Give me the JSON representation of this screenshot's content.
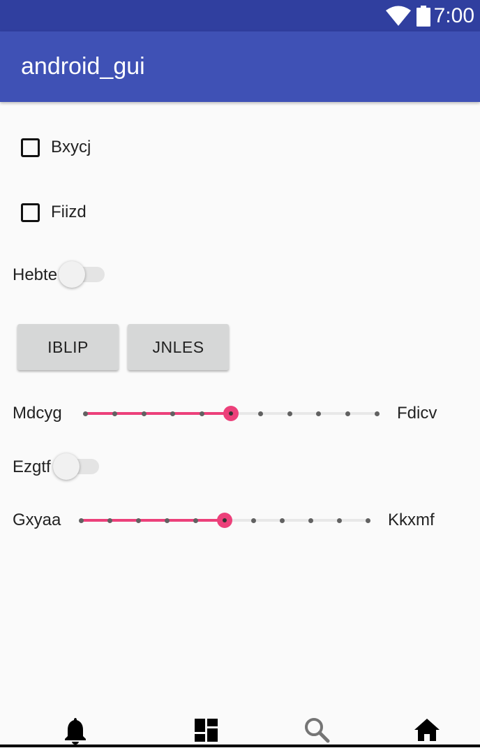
{
  "status_bar": {
    "time": "7:00",
    "icons": [
      "wifi-icon",
      "battery-icon"
    ]
  },
  "app_bar": {
    "title": "android_gui"
  },
  "checkboxes": [
    {
      "label": "Bxycj",
      "checked": false
    },
    {
      "label": "Fiizd",
      "checked": false
    }
  ],
  "switches": [
    {
      "label": "Hebte",
      "on": false
    },
    {
      "label": "Ezgtf",
      "on": false
    }
  ],
  "buttons": [
    {
      "label": "IBLIP"
    },
    {
      "label": "JNLES"
    }
  ],
  "sliders": [
    {
      "left_label": "Mdcyg",
      "right_label": "Fdicv",
      "value": 5,
      "max": 10
    },
    {
      "left_label": "Gxyaa",
      "right_label": "Kkxmf",
      "value": 5,
      "max": 10
    }
  ],
  "colors": {
    "status_bar": "#303f9f",
    "app_bar": "#3f51b5",
    "accent": "#ec407a",
    "background": "#fafafa"
  },
  "bottom_nav": {
    "items": [
      {
        "icon": "bell-icon"
      },
      {
        "icon": "dashboard-icon"
      },
      {
        "icon": "search-icon"
      },
      {
        "icon": "home-icon"
      }
    ]
  }
}
